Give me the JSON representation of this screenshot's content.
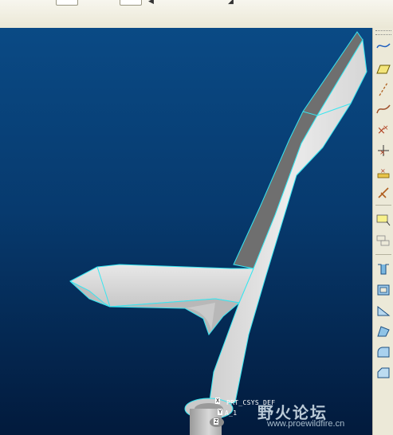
{
  "toolbar": {
    "glyphs": [
      "◀",
      "◢"
    ]
  },
  "model": {
    "csys_label": "PRT_CSYS_DEF",
    "axis_label": "A_1",
    "tag_x": "X",
    "tag_y": "Y",
    "tag_z": "Z"
  },
  "right_toolbar": {
    "icons": [
      "datum-curve-icon",
      "datum-plane-icon",
      "datum-axis-icon",
      "sketched-curve-icon",
      "datum-point-icon",
      "offset-point-icon",
      "field-point-icon",
      "datum-csys-icon",
      "note-icon",
      "layer-icon",
      "hole-icon",
      "shell-icon",
      "rib-icon",
      "draft-icon",
      "round-icon",
      "chamfer-icon"
    ]
  },
  "watermark": {
    "title": "野火论坛",
    "url": "www.proewildfire.cn"
  },
  "colors": {
    "viewport_top": "#0a4a85",
    "viewport_bottom": "#021a3c",
    "edge": "#37e6f0",
    "face_light": "#e6e6e6",
    "face_shade": "#8a8a8a"
  }
}
